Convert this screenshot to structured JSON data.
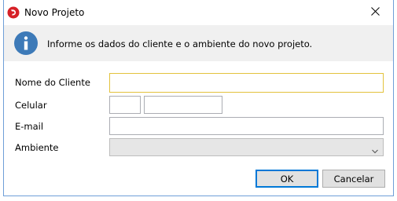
{
  "window": {
    "title": "Novo Projeto",
    "app_icon": "app-logo-icon",
    "close_icon": "close-icon"
  },
  "banner": {
    "icon": "info-icon",
    "message": "Informe os dados do cliente e o ambiente do novo projeto."
  },
  "form": {
    "nome_label": "Nome do Cliente",
    "nome_value": "",
    "celular_label": "Celular",
    "celular_ddd_value": "",
    "celular_numero_value": "",
    "email_label": "E-mail",
    "email_value": "",
    "ambiente_label": "Ambiente",
    "ambiente_value": ""
  },
  "buttons": {
    "ok_label": "OK",
    "cancel_label": "Cancelar"
  },
  "colors": {
    "accent": "#0078d7",
    "focus_border": "#e3c23c",
    "info_icon": "#3d7ab8",
    "app_icon": "#d62027",
    "banner_bg": "#f0f0f0"
  }
}
